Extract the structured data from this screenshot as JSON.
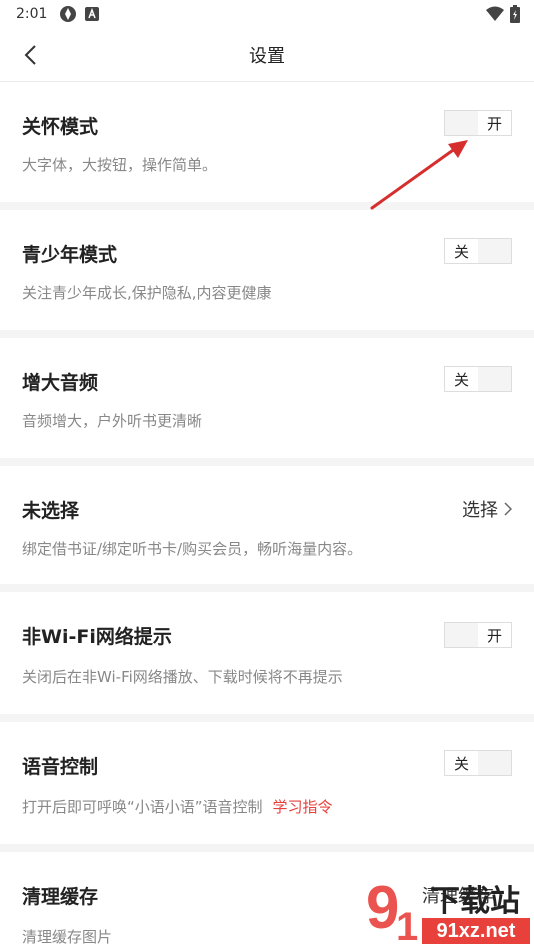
{
  "status_bar": {
    "time": "2:01"
  },
  "header": {
    "title": "设置"
  },
  "sections": [
    {
      "title": "关怀模式",
      "desc": "大字体，大按钮，操作简单。",
      "toggle_off": "关",
      "toggle_on": "开",
      "state": "on"
    },
    {
      "title": "青少年模式",
      "desc": "关注青少年成长,保护隐私,内容更健康",
      "toggle_off": "关",
      "toggle_on": "开",
      "state": "off"
    },
    {
      "title": "增大音频",
      "desc": "音频增大，户外听书更清晰",
      "toggle_off": "关",
      "toggle_on": "开",
      "state": "off"
    },
    {
      "title": "未选择",
      "desc": "绑定借书证/绑定听书卡/购买会员，畅听海量内容。",
      "action_label": "选择"
    },
    {
      "title": "非Wi-Fi网络提示",
      "desc": "关闭后在非Wi-Fi网络播放、下载时候将不再提示",
      "toggle_off": "关",
      "toggle_on": "开",
      "state": "on"
    },
    {
      "title": "语音控制",
      "desc": "打开后即可呼唤“小语小语”语音控制",
      "link": "学习指令",
      "toggle_off": "关",
      "toggle_on": "开",
      "state": "off"
    },
    {
      "title": "清理缓存",
      "desc": "清理缓存图片",
      "action_label": "清理缓存"
    }
  ],
  "watermark": {
    "brand": "下载站",
    "domain": "91xz.net"
  },
  "colors": {
    "accent": "#e8413c",
    "divider": "#f4f4f4",
    "arrow": "#d62d2d"
  }
}
